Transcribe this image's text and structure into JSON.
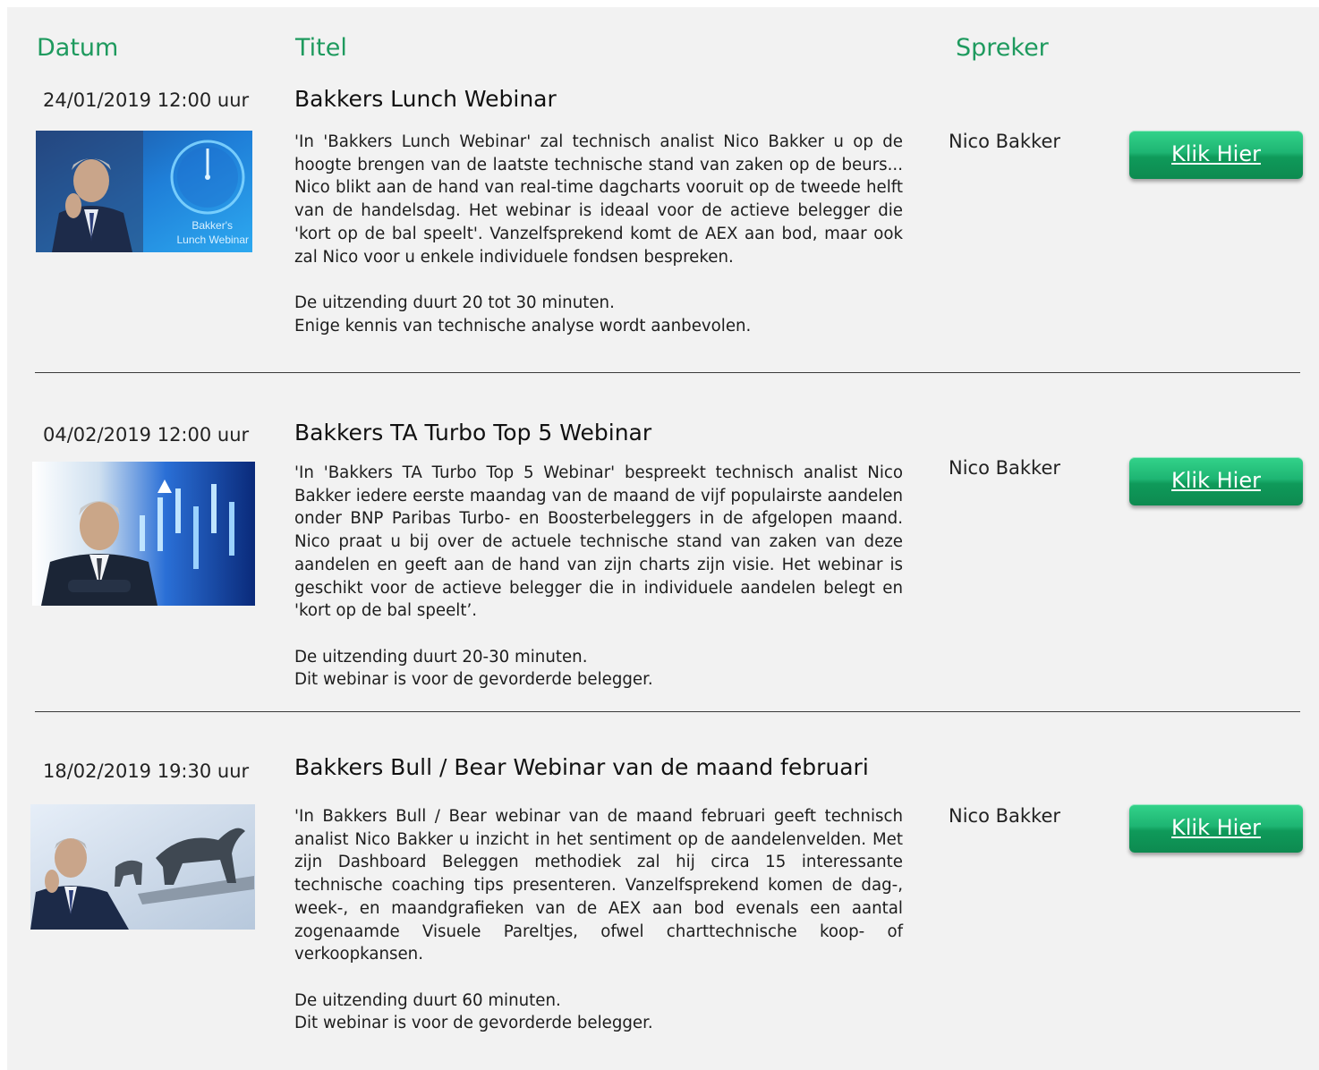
{
  "headers": {
    "date": "Datum",
    "title": "Titel",
    "speaker": "Spreker"
  },
  "webinars": [
    {
      "date": "24/01/2019 12:00 uur",
      "title": "Bakkers Lunch Webinar",
      "description": "'In 'Bakkers Lunch Webinar' zal technisch analist Nico Bakker u op de hoogte brengen van de laatste technische stand van zaken op de beurs... Nico blikt aan de hand van real-time dagcharts vooruit op de tweede helft van de handelsdag. Het webinar is ideaal voor de actieve belegger die 'kort op de bal speelt'. Vanzelfsprekend komt de AEX aan bod, maar ook zal Nico voor u enkele individuele fondsen bespreken.",
      "duration": "De uitzending duurt 20 tot 30 minuten.",
      "level": "Enige kennis van technische analyse wordt aanbevolen.",
      "speaker": "Nico Bakker",
      "button": "Klik Hier",
      "thumb_caption_1": "Bakker's",
      "thumb_caption_2": "Lunch Webinar"
    },
    {
      "date": "04/02/2019 12:00 uur",
      "title": "Bakkers TA Turbo Top 5 Webinar",
      "description": "'In 'Bakkers TA Turbo Top 5 Webinar' bespreekt technisch analist Nico Bakker iedere eerste maandag van de maand de vijf populairste aandelen onder BNP Paribas Turbo- en Boosterbeleggers in de afgelopen maand. Nico praat u bij over de actuele technische stand van zaken van deze aandelen en geeft aan de hand van zijn charts zijn visie. Het webinar is geschikt voor de actieve belegger die in individuele aandelen belegt en 'kort op de bal speelt’.",
      "duration": "De uitzending duurt 20-30 minuten.",
      "level": "Dit webinar is voor de gevorderde belegger.",
      "speaker": "Nico Bakker",
      "button": "Klik Hier"
    },
    {
      "date": "18/02/2019 19:30 uur",
      "title": "Bakkers Bull / Bear Webinar van de maand februari",
      "description": "'In Bakkers Bull / Bear webinar van de maand februari geeft technisch analist Nico Bakker u inzicht in het sentiment op de aandelenvelden. Met zijn Dashboard Beleggen methodiek zal hij circa 15 interessante technische coaching tips presenteren. Vanzelfsprekend komen de dag-, week-, en maandgrafieken van de AEX aan bod evenals een aantal zogenaamde Visuele Pareltjes, ofwel charttechnische koop- of verkoopkansen.",
      "duration": "De uitzending duurt 60 minuten.",
      "level": "Dit webinar is voor de gevorderde belegger.",
      "speaker": "Nico Bakker",
      "button": "Klik Hier"
    }
  ]
}
